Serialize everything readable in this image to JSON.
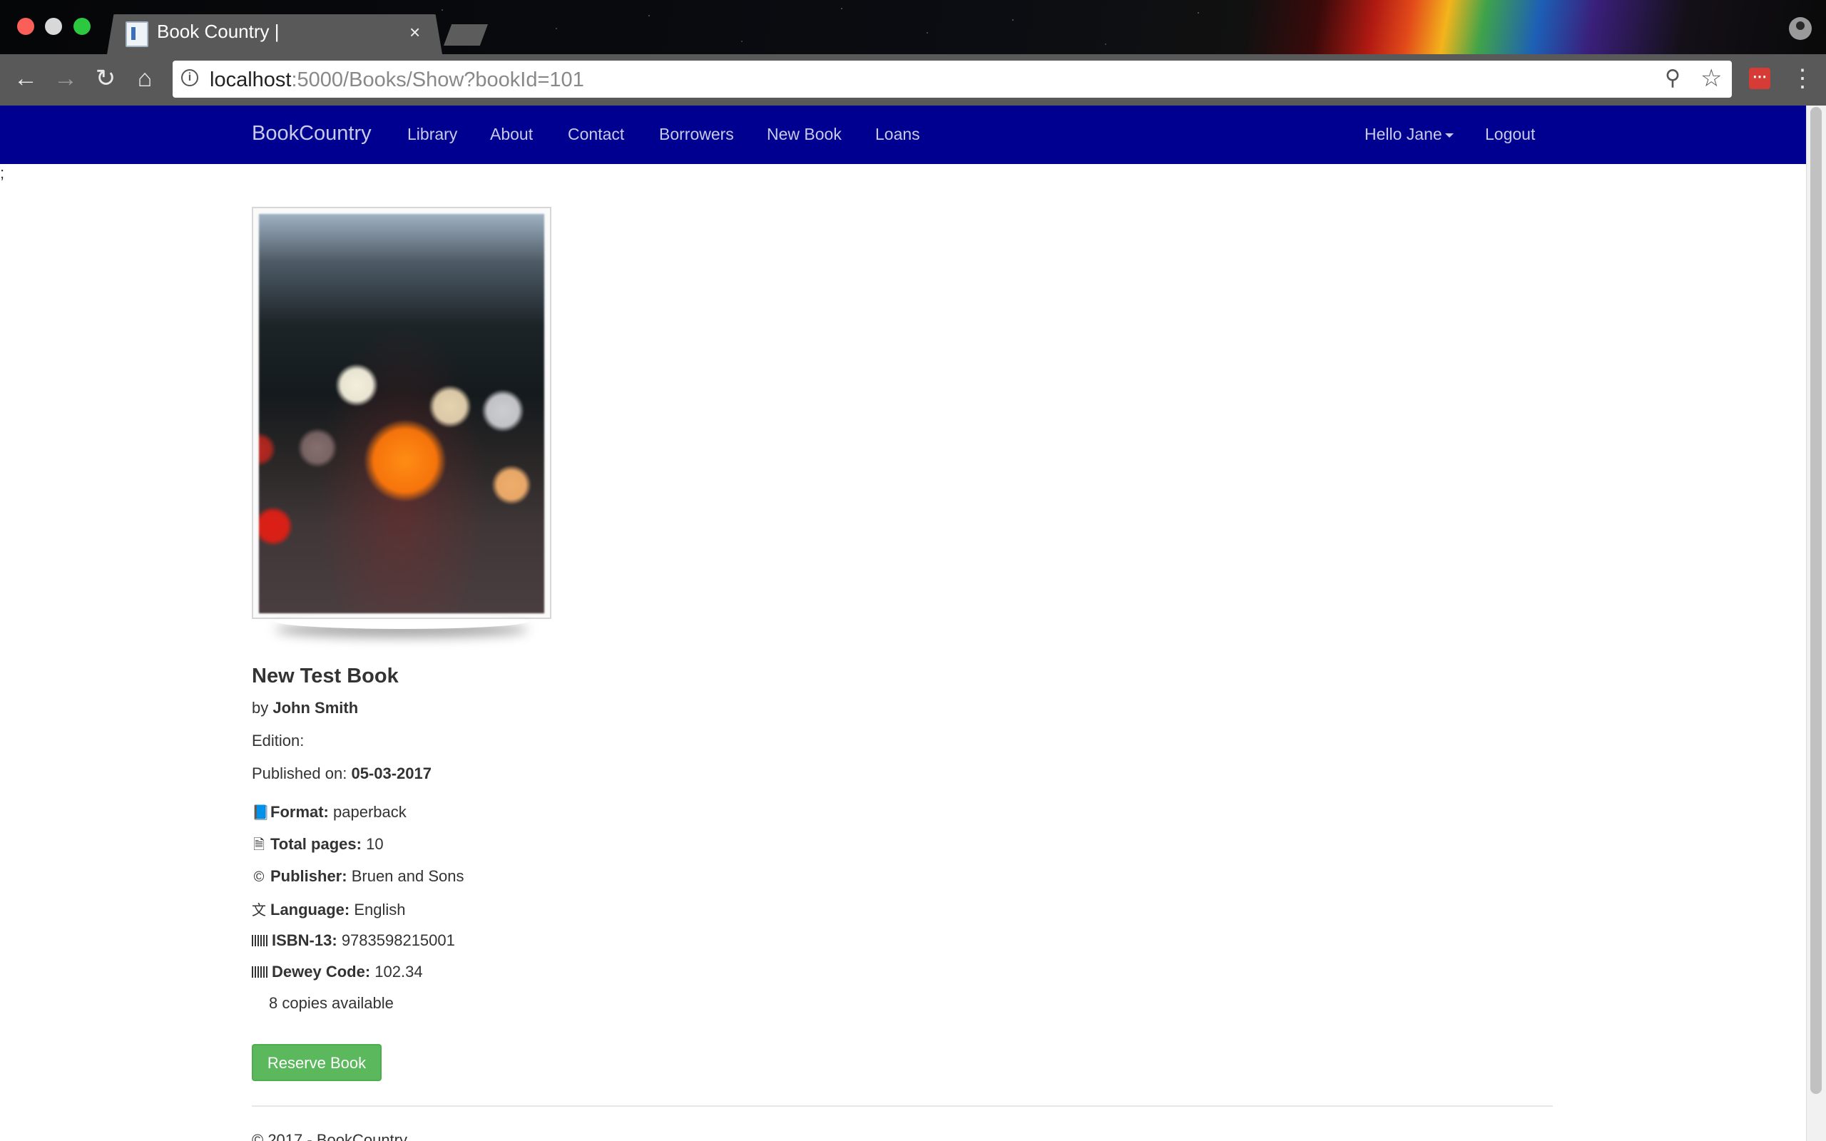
{
  "browser": {
    "tab_title": "Book Country |",
    "tab_close_glyph": "×",
    "url_host": "localhost",
    "url_rest": ":5000/Books/Show?bookId=101"
  },
  "navbar": {
    "brand": "BookCountry",
    "links": [
      "Library",
      "About",
      "Contact",
      "Borrowers",
      "New Book",
      "Loans"
    ],
    "user_menu": "Hello Jane",
    "logout": "Logout",
    "color": "#000090"
  },
  "stray_text": ";",
  "book": {
    "title": "New Test Book",
    "by_label": "by",
    "author": "John Smith",
    "edition_label": "Edition:",
    "edition_value": "",
    "published_label": "Published on:",
    "published_value": "05-03-2017",
    "format_label": "Format:",
    "format_value": "paperback",
    "pages_label": "Total pages:",
    "pages_value": "10",
    "publisher_label": "Publisher:",
    "publisher_value": "Bruen and Sons",
    "language_label": "Language:",
    "language_value": "English",
    "isbn_label": "ISBN-13:",
    "isbn_value": "9783598215001",
    "dewey_label": "Dewey Code:",
    "dewey_value": "102.34",
    "copies": "8 copies available"
  },
  "actions": {
    "reserve": "Reserve Book",
    "reserve_color": "#5cb85c"
  },
  "footer": {
    "text": "© 2017 - BookCountry"
  },
  "icons": {
    "format": "book-icon",
    "pages": "file-icon",
    "publisher": "copyright-icon",
    "language": "language-icon",
    "isbn": "barcode-icon",
    "dewey": "barcode-icon"
  }
}
